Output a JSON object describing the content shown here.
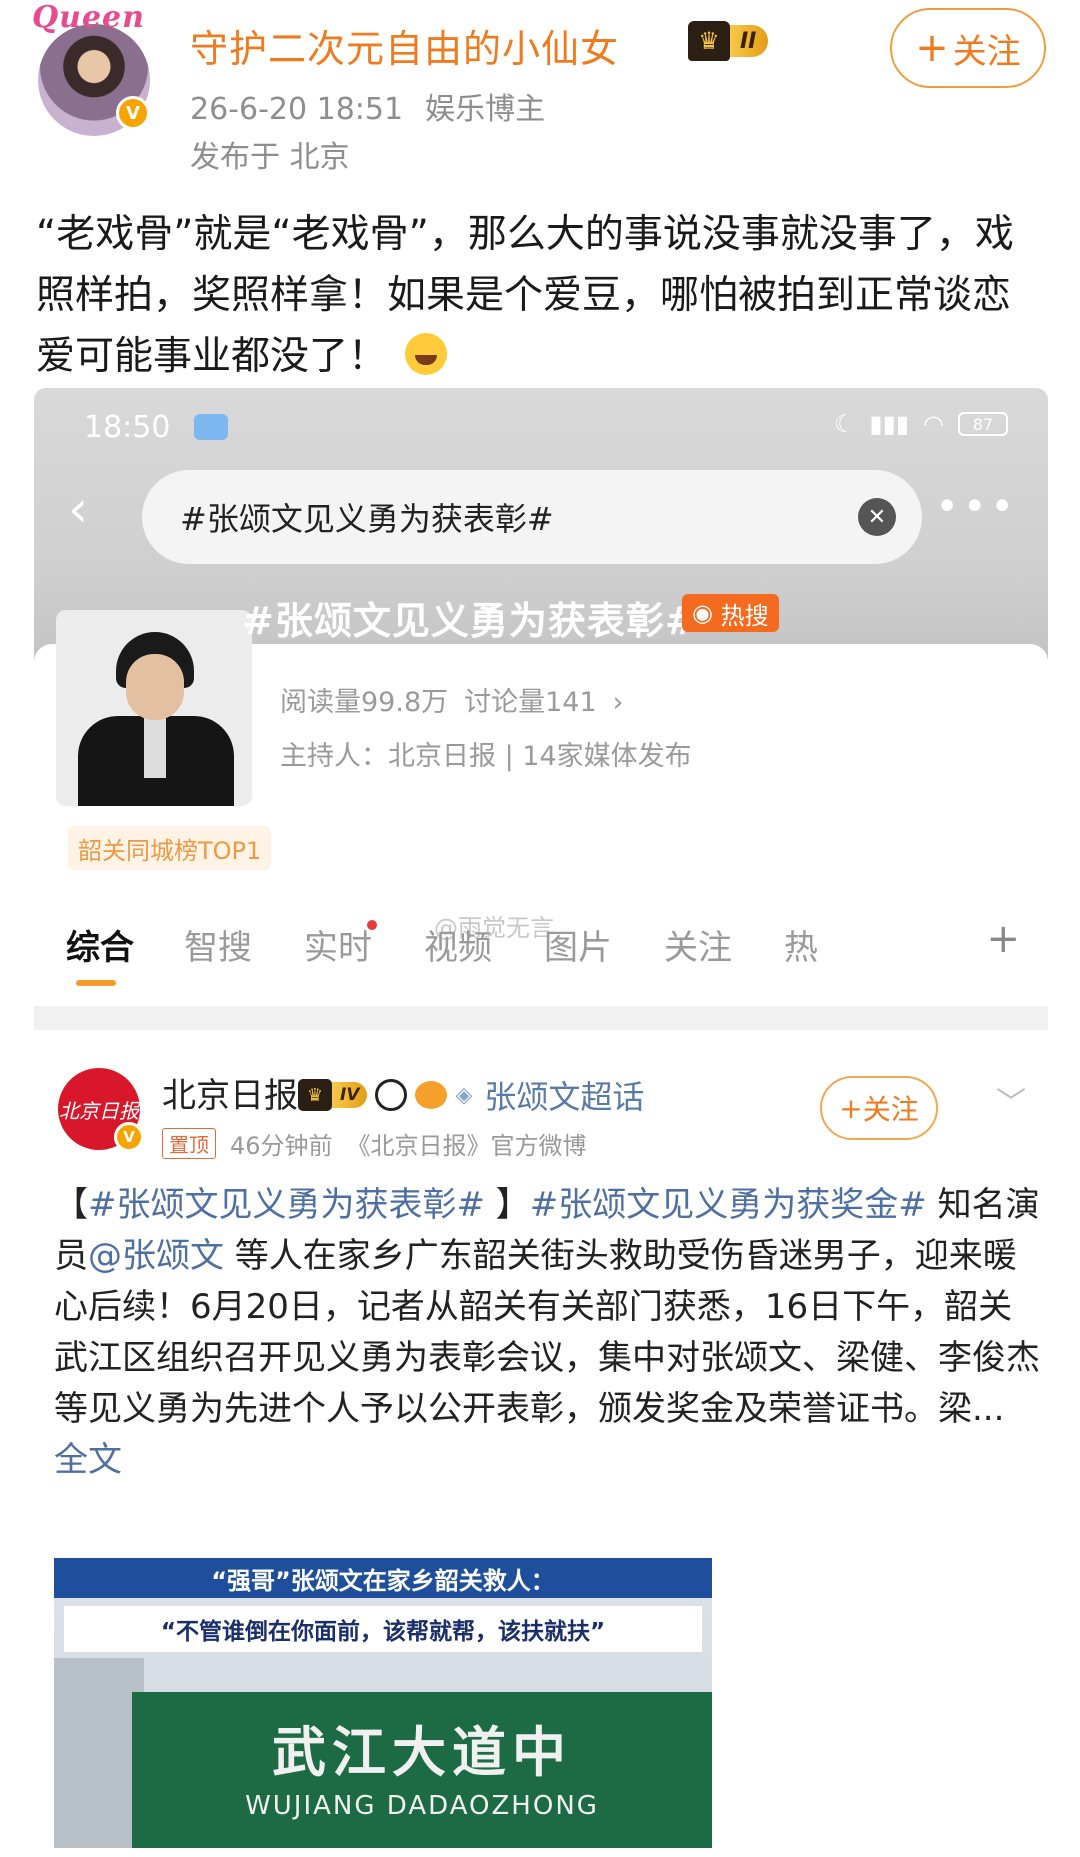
{
  "post": {
    "avatar_deco": "Queen",
    "username": "守护二次元自由的小仙女",
    "level_badge": "II",
    "follow_label": "关注",
    "time": "26-6-20 18:51",
    "role": "娱乐博主",
    "location": "发布于 北京",
    "text": "“老戏骨”就是“老戏骨”，那么大的事说没事就没事了，戏照样拍，奖照样拿！如果是个爱豆，哪怕被拍到正常谈恋爱可能事业都没了！"
  },
  "screenshot": {
    "status_time": "18:50",
    "battery": "87",
    "search_query": "#张颂文见义勇为获表彰#",
    "topic_title": "#张颂文见义勇为获表彰#",
    "hot_tag": "热搜",
    "reads": "阅读量99.8万",
    "discussions": "讨论量141",
    "host": "主持人：北京日报 | 14家媒体发布",
    "rank_tag": "韶关同城榜TOP1",
    "tabs": [
      "综合",
      "智搜",
      "实时",
      "视频",
      "图片",
      "关注",
      "热"
    ],
    "watermark": "@雨觉无言",
    "sub_post": {
      "avatar_text": "北京日报",
      "name": "北京日报",
      "level_badge": "IV",
      "supertopic": "张颂文超话",
      "follow_label": "关注",
      "pin": "置顶",
      "time": "46分钟前",
      "source": "《北京日报》官方微博",
      "text_prefix": "【",
      "tag1": "#张颂文见义勇为获表彰#",
      "text_mid1": " 】",
      "tag2": "#张颂文见义勇为获奖金#",
      "text_mid2": " 知名演员",
      "mention": "@张颂文",
      "text_body": " 等人在家乡广东韶关街头救助受伤昏迷男子，迎来暖心后续！6月20日，记者从韶关有关部门获悉，16日下午，韶关武江区组织召开见义勇为表彰会议，集中对张颂文、梁健、李俊杰等见义勇为先进个人予以公开表彰，颁发奖金及荣誉证书。梁... ",
      "full_text": "全文"
    },
    "news_image": {
      "banner": "“强哥”张颂文在家乡韶关救人：",
      "quote": "“不管谁倒在你面前，该帮就帮，该扶就扶”",
      "sign_cn": "武江大道中",
      "sign_py": "WUJIANG DADAOZHONG"
    }
  },
  "colors": {
    "accent": "#f07a1e",
    "link": "#4f6fa3",
    "hot": "#f46a1e"
  }
}
